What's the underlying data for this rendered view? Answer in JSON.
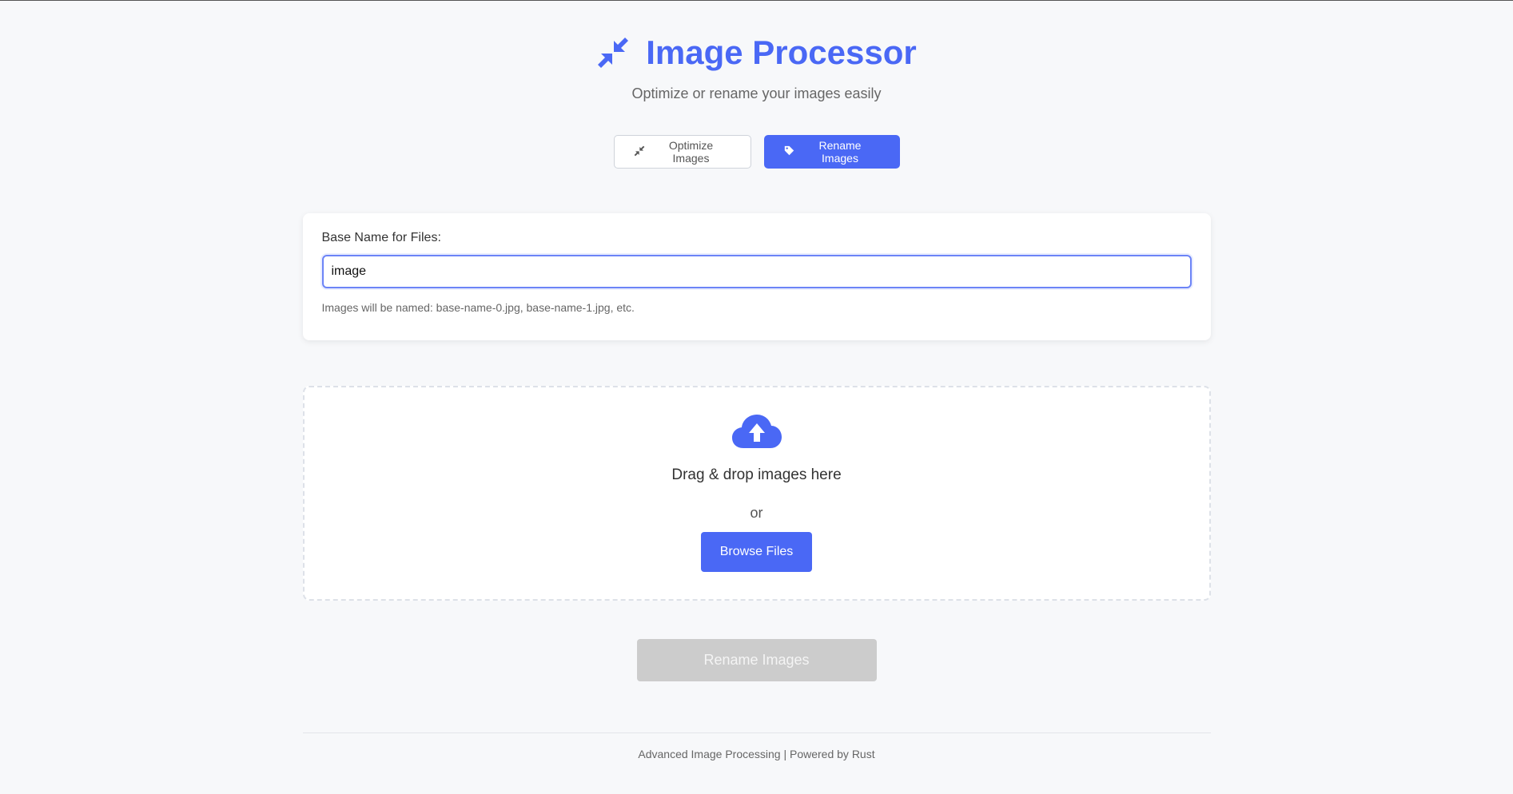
{
  "header": {
    "title": "Image Processor",
    "subtitle": "Optimize or rename your images easily"
  },
  "mode_toggle": {
    "optimize_label": "Optimize Images",
    "rename_label": "Rename Images",
    "active": "rename"
  },
  "rename_settings": {
    "label": "Base Name for Files:",
    "value": "image",
    "hint": "Images will be named: base-name-0.jpg, base-name-1.jpg, etc."
  },
  "dropzone": {
    "drop_text": "Drag & drop images here",
    "or_text": "or",
    "browse_label": "Browse Files"
  },
  "action": {
    "label": "Rename Images",
    "enabled": false
  },
  "footer": {
    "text": "Advanced Image Processing | Powered by Rust"
  },
  "colors": {
    "accent": "#4a68f5",
    "disabled": "#cccccc",
    "background": "#f7f8fa"
  },
  "icons": {
    "title": "compress-icon",
    "optimize": "compress-icon",
    "rename": "tag-icon",
    "upload": "cloud-upload-icon"
  }
}
